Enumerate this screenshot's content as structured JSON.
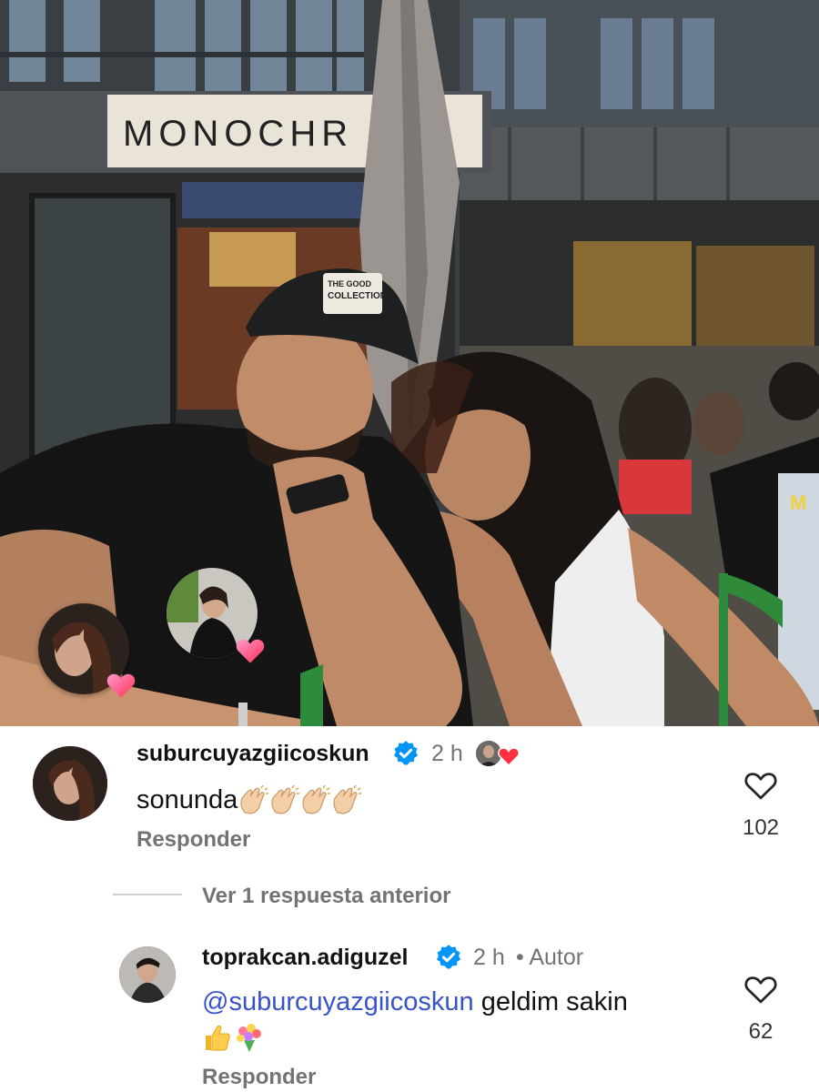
{
  "photo": {
    "sign_text": "MONOCHR",
    "cap_text": "THE GOOD\nCOLLECTION",
    "shirt_text": "M"
  },
  "comments": [
    {
      "username": "suburcuyazgiicoskun",
      "verified": true,
      "time": "2 h",
      "text": "sonunda",
      "emoji": [
        "clapping-hands",
        "clapping-hands",
        "clapping-hands",
        "clapping-hands"
      ],
      "reply_label": "Responder",
      "likes": "102",
      "liked_by_author": true
    },
    {
      "username": "toprakcan.adiguzel",
      "verified": true,
      "time": "2 h",
      "author_tag": "• Autor",
      "mention": "@suburcuyazgiicoskun",
      "text": " geldim sakin",
      "emoji": [
        "thumbs-up",
        "bouquet"
      ],
      "reply_label": "Responder",
      "likes": "62"
    }
  ],
  "view_replies_label": "Ver 1 respuesta anterior",
  "colors": {
    "verified_blue": "#0095f6",
    "mention_blue": "#3853c8",
    "heart_red": "#ff3040",
    "muted_text": "#737373"
  }
}
